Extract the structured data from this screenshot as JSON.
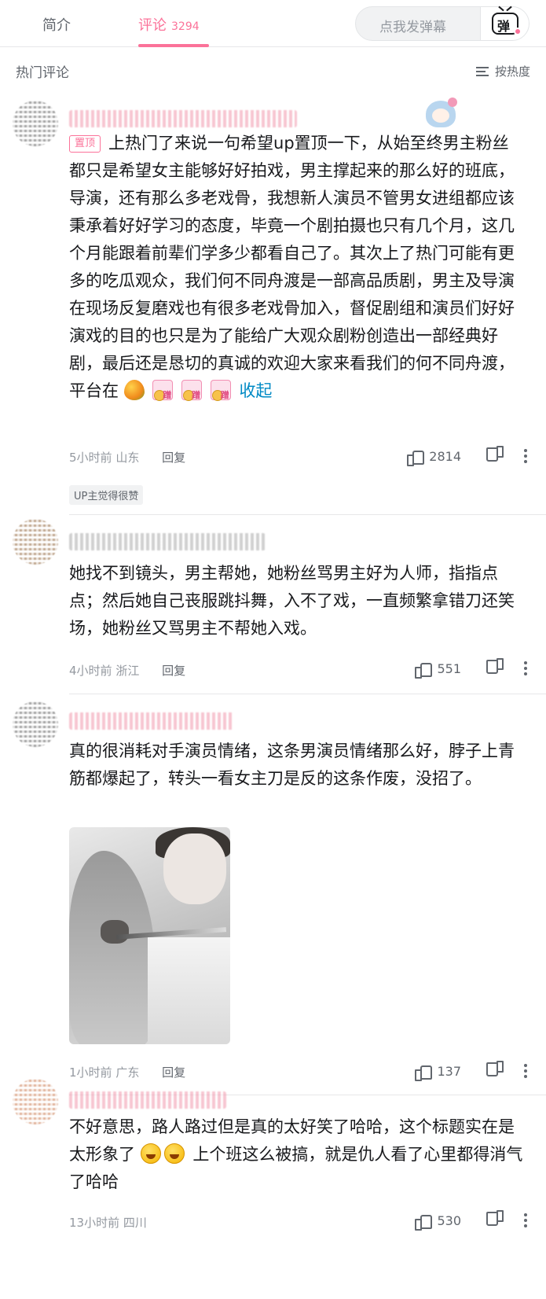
{
  "tabs": {
    "intro": "简介",
    "comments": "评论",
    "comments_count": "3294"
  },
  "danmaku": {
    "placeholder": "点我发弹幕",
    "button_glyph": "弹"
  },
  "section": {
    "title": "热门评论",
    "sort_label": "按热度"
  },
  "comments": [
    {
      "pinned_label": "置顶",
      "text": "上热门了来说一句希望up置顶一下，从始至终男主粉丝都只是希望女主能够好好拍戏，男主撑起来的那么好的班底，导演，还有那么多老戏骨，我想新人演员不管男女进组都应该秉承着好好学习的态度，毕竟一个剧拍摄也只有几个月，这几个月能跟着前辈们学多少都看自己了。其次上了热门可能有更多的吃瓜观众，我们何不同舟渡是一部高品质剧，男主及导演在现场反复磨戏也有很多老戏骨加入，督促剧组和演员们好好演戏的目的也只是为了能给广大观众剧粉创造出一部经典好剧，最后还是恳切的真诚的欢迎大家来看我们的何不同舟渡，平台在",
      "collapse_label": "收起",
      "time": "5小时前",
      "location": "山东",
      "reply": "回复",
      "likes": "2814",
      "up_badge": "UP主觉得很赞"
    },
    {
      "text": "她找不到镜头，男主帮她，她粉丝骂男主好为人师，指指点点；然后她自己丧服跳抖舞，入不了戏，一直频繁拿错刀还笑场，她粉丝又骂男主不帮她入戏。",
      "time": "4小时前",
      "location": "浙江",
      "reply": "回复",
      "likes": "551"
    },
    {
      "text": "真的很消耗对手演员情绪，这条男演员情绪那么好，脖子上青筋都爆起了，转头一看女主刀是反的这条作废，没招了。",
      "time": "1小时前",
      "location": "广东",
      "reply": "回复",
      "likes": "137"
    },
    {
      "text_part1": "不好意思，路人路过但是真的太好笑了哈哈，这个标题实在是太形象了",
      "text_part2": "上个班这么被搞，就是仇人看了心里都得消气了哈哈",
      "time": "13小时前",
      "location": "四川",
      "likes": "530"
    }
  ],
  "icons": {
    "like": "thumbs-up-icon",
    "dislike": "thumbs-down-icon",
    "more": "more-vertical-icon",
    "sort": "sort-lines-icon",
    "danmaku": "tv-icon"
  },
  "colors": {
    "accent": "#fb7299",
    "link": "#008ac5",
    "text": "#18191c",
    "muted": "#9499a0"
  }
}
